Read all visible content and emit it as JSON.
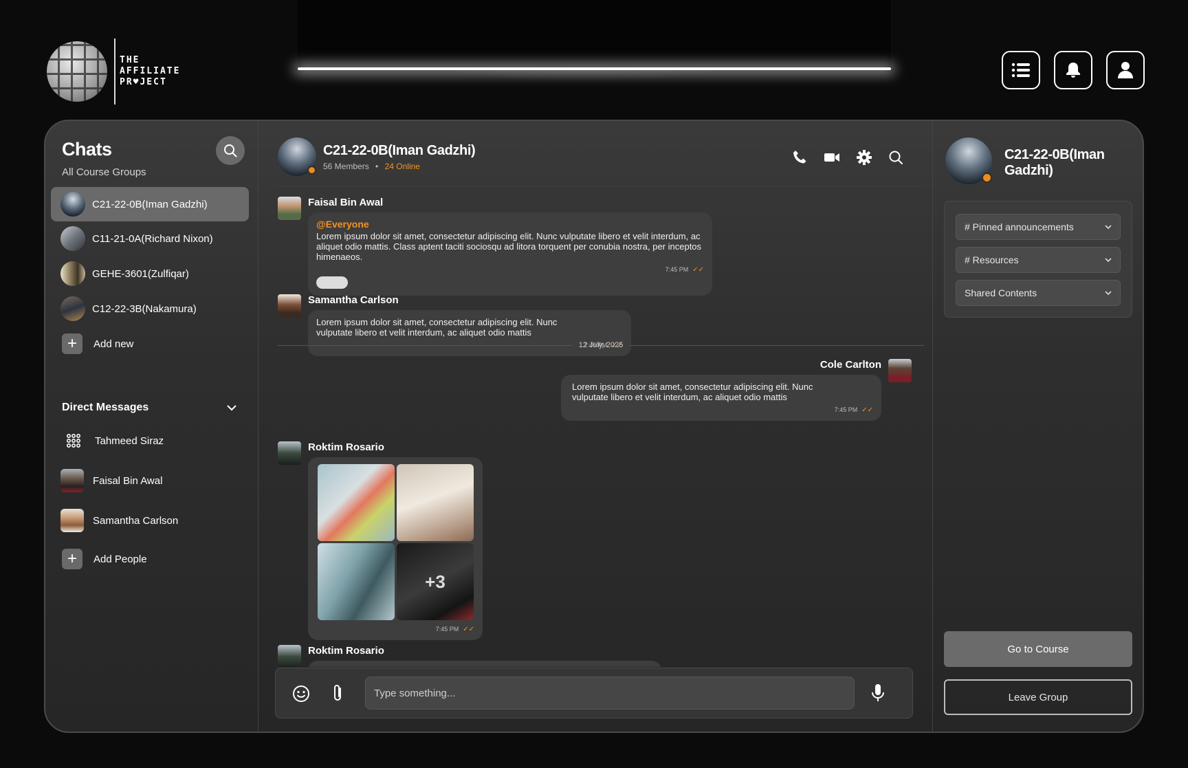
{
  "brand": {
    "line1": "THE",
    "line2": "AFFILIATE",
    "line3": "PR♥JECT"
  },
  "top_actions": [
    {
      "name": "menu-button",
      "icon": "list-icon"
    },
    {
      "name": "notifications-button",
      "icon": "bell-icon"
    },
    {
      "name": "profile-button",
      "icon": "user-icon"
    }
  ],
  "sidebar": {
    "title": "Chats",
    "subtitle": "All Course Groups",
    "groups": [
      {
        "label": "C21-22-0B(Iman Gadzhi)",
        "active": true
      },
      {
        "label": "C11-21-0A(Richard Nixon)",
        "active": false
      },
      {
        "label": "GEHE-3601(Zulfiqar)",
        "active": false
      },
      {
        "label": "C12-22-3B(Nakamura)",
        "active": false
      }
    ],
    "add_new_label": "Add new",
    "dm_title": "Direct Messages",
    "direct_messages": [
      {
        "label": "Tahmeed Siraz",
        "icon": "grid-dots-icon"
      },
      {
        "label": "Faisal Bin Awal"
      },
      {
        "label": "Samantha Carlson"
      }
    ],
    "add_people_label": "Add People"
  },
  "chat": {
    "group_name": "C21-22-0B(Iman Gadzhi)",
    "members": "56 Members",
    "separator": "•",
    "online": "24 Online",
    "header_icons": [
      "phone-icon",
      "video-icon",
      "gear-icon",
      "search-icon"
    ],
    "messages": [
      {
        "sender": "Faisal Bin Awal",
        "mention": "@Everyone",
        "text": "Lorem ipsum dolor sit amet, consectetur adipiscing elit. Nunc vulputate libero et velit interdum, ac aliquet odio mattis. Class aptent taciti sociosqu ad litora torquent per conubia nostra, per inceptos himenaeos.",
        "time": "7:45 PM"
      },
      {
        "sender": "Samantha Carlson",
        "text": "Lorem ipsum dolor sit amet, consectetur adipiscing elit. Nunc vulputate libero et velit interdum, ac aliquet odio mattis",
        "time": "7:45 PM"
      },
      {
        "sender": "Cole Carlton",
        "text": "Lorem ipsum dolor sit amet, consectetur adipiscing elit. Nunc vulputate libero et velit interdum, ac aliquet odio mattis",
        "time": "7:45 PM"
      },
      {
        "sender": "Roktim Rosario",
        "more_images": "+3",
        "time": "7:45 PM"
      },
      {
        "sender": "Roktim Rosario"
      }
    ],
    "date_divider": "12 July, 2025",
    "composer_placeholder": "Type something..."
  },
  "info": {
    "group_name": "C21-22-0B(Iman Gadzhi)",
    "sections": [
      "# Pinned announcements",
      "# Resources",
      "Shared Contents"
    ],
    "go_label": "Go to Course",
    "leave_label": "Leave Group"
  },
  "colors": {
    "accent": "#f5941e",
    "card": "#2e2e2e",
    "active": "#6a6a6a"
  }
}
